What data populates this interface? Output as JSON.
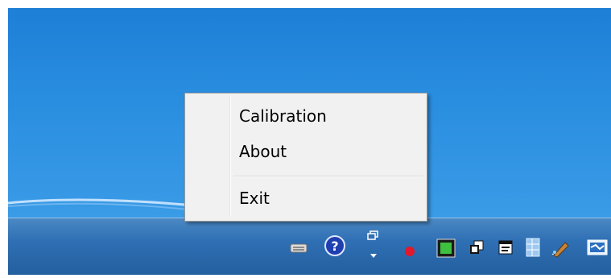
{
  "context_menu": {
    "items": [
      {
        "label": "Calibration"
      },
      {
        "label": "About"
      },
      {
        "label": "Exit"
      }
    ]
  },
  "tray": {
    "icons": [
      "keyboard-icon",
      "help-icon",
      "restore-window-icon",
      "red-dot-icon",
      "green-chip-icon",
      "windows-copy-icon",
      "notepad-icon",
      "grid-icon",
      "pen-icon",
      "network-monitor-icon"
    ],
    "colors": {
      "help": "#1f3fb0",
      "red_dot": "#e3182b",
      "green": "#3fbf3f"
    }
  },
  "colors": {
    "desktop": "#2a8ee0",
    "taskbar": "#2f6fb4",
    "menu_bg": "#f1f1f1"
  }
}
